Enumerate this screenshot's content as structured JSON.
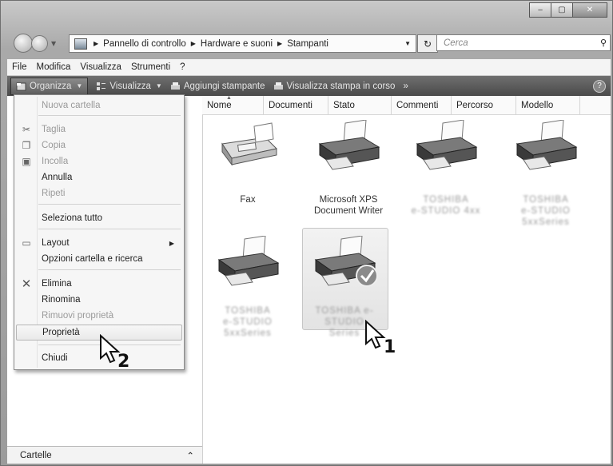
{
  "address_bar": {
    "crumbs": [
      "Pannello di controllo",
      "Hardware e suoni",
      "Stampanti"
    ]
  },
  "search": {
    "placeholder": "Cerca"
  },
  "menubar": [
    "File",
    "Modifica",
    "Visualizza",
    "Strumenti",
    "?"
  ],
  "toolbar": {
    "organize": "Organizza",
    "view": "Visualizza",
    "add_printer": "Aggiungi stampante",
    "see_print": "Visualizza stampa in corso",
    "more": "»",
    "help": "?"
  },
  "columns": [
    "Nome",
    "Documenti",
    "Stato",
    "Commenti",
    "Percorso",
    "Modello"
  ],
  "items": [
    {
      "label1": "Fax",
      "label2": ""
    },
    {
      "label1": "Microsoft XPS",
      "label2": "Document Writer"
    },
    {
      "label1": "TOSHIBA",
      "label2": "e-STUDIO 4xx"
    },
    {
      "label1": "TOSHIBA",
      "label2": "e-STUDIO 5xxSeries"
    },
    {
      "label1": "TOSHIBA",
      "label2": "e-STUDIO 5xxSeries"
    },
    {
      "label1": "TOSHIBA e-STUDIO",
      "label2": "Series"
    }
  ],
  "context_menu": {
    "new_folder": "Nuova cartella",
    "cut": "Taglia",
    "copy": "Copia",
    "paste": "Incolla",
    "undo": "Annulla",
    "redo": "Ripeti",
    "select_all": "Seleziona tutto",
    "layout": "Layout",
    "folder_options": "Opzioni cartella e ricerca",
    "delete": "Elimina",
    "rename": "Rinomina",
    "remove_props": "Rimuovi proprietà",
    "properties": "Proprietà",
    "close": "Chiudi"
  },
  "left_pane": {
    "folders": "Cartelle"
  },
  "callouts": {
    "one": "1",
    "two": "2"
  }
}
